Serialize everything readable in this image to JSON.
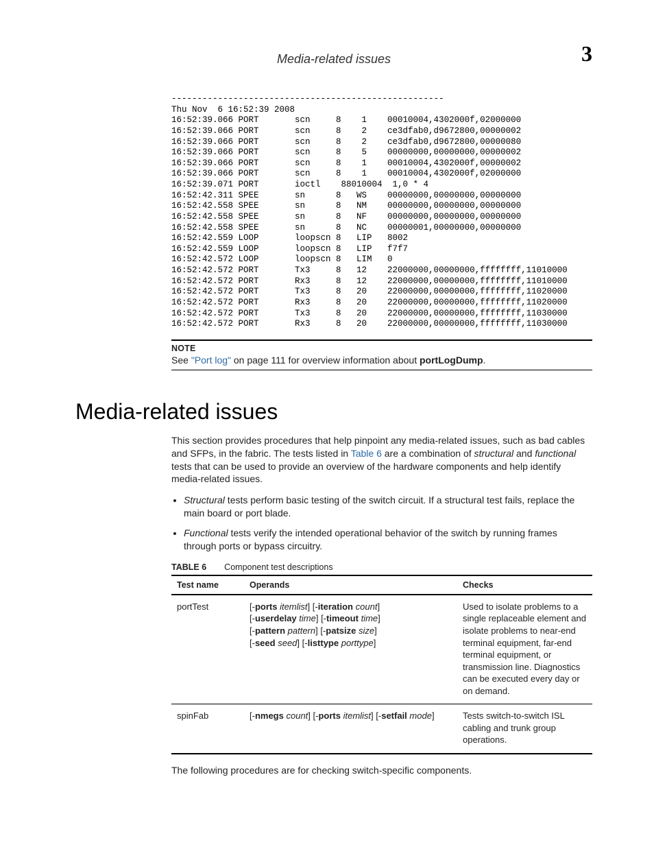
{
  "runningHead": {
    "title": "Media-related issues",
    "chapter": "3"
  },
  "log": "-----------------------------------------------------\nThu Nov  6 16:52:39 2008\n16:52:39.066 PORT       scn     8    1    00010004,4302000f,02000000\n16:52:39.066 PORT       scn     8    2    ce3dfab0,d9672800,00000002\n16:52:39.066 PORT       scn     8    2    ce3dfab0,d9672800,00000080\n16:52:39.066 PORT       scn     8    5    00000000,00000000,00000002\n16:52:39.066 PORT       scn     8    1    00010004,4302000f,00000002\n16:52:39.066 PORT       scn     8    1    00010004,4302000f,02000000\n16:52:39.071 PORT       ioctl    88010004  1,0 * 4\n16:52:42.311 SPEE       sn      8   WS    00000000,00000000,00000000\n16:52:42.558 SPEE       sn      8   NM    00000000,00000000,00000000\n16:52:42.558 SPEE       sn      8   NF    00000000,00000000,00000000\n16:52:42.558 SPEE       sn      8   NC    00000001,00000000,00000000\n16:52:42.559 LOOP       loopscn 8   LIP   8002\n16:52:42.559 LOOP       loopscn 8   LIP   f7f7\n16:52:42.572 LOOP       loopscn 8   LIM   0\n16:52:42.572 PORT       Tx3     8   12    22000000,00000000,ffffffff,11010000\n16:52:42.572 PORT       Rx3     8   12    22000000,00000000,ffffffff,11010000\n16:52:42.572 PORT       Tx3     8   20    22000000,00000000,ffffffff,11020000\n16:52:42.572 PORT       Rx3     8   20    22000000,00000000,ffffffff,11020000\n16:52:42.572 PORT       Tx3     8   20    22000000,00000000,ffffffff,11030000\n16:52:42.572 PORT       Rx3     8   20    22000000,00000000,ffffffff,11030000",
  "note": {
    "label": "NOTE",
    "pre": "See ",
    "link": "\"Port log\"",
    "mid": " on page 111 for overview information about ",
    "cmd": "portLogDump",
    "post": "."
  },
  "section": {
    "heading": "Media-related issues",
    "intro": {
      "p1a": "This section provides procedures that help pinpoint any media-related issues, such as bad cables and SFPs, in the fabric. The tests listed in ",
      "p1link": "Table 6",
      "p1b": " are a combination of ",
      "p1i1": "structural",
      "p1c": " and ",
      "p1i2": "functional",
      "p1d": " tests that can be used to provide an overview of the hardware components and help identify media-related issues."
    },
    "bullets": [
      {
        "em": "Structural",
        "text": " tests perform basic testing of the switch circuit. If a structural test fails, replace the main board or port blade."
      },
      {
        "em": "Functional",
        "text": " tests verify the intended operational behavior of the switch by running frames through ports or bypass circuitry."
      }
    ],
    "tableCaption": {
      "label": "TABLE 6",
      "title": "Component test descriptions"
    },
    "tableHead": {
      "c1": "Test name",
      "c2": "Operands",
      "c3": "Checks"
    },
    "rows": [
      {
        "name": "portTest",
        "ops": [
          [
            "[-",
            "ports",
            " ",
            "itemlist",
            "] [-",
            "iteration",
            " ",
            "count",
            "]"
          ],
          [
            "[-",
            "userdelay",
            " ",
            "time",
            "] [-",
            "timeout",
            " ",
            "time",
            "]"
          ],
          [
            "[-",
            "pattern",
            " ",
            "pattern",
            "] [-",
            "patsize",
            " ",
            "size",
            "]"
          ],
          [
            "[-",
            "seed",
            " ",
            "seed",
            "] [-",
            "listtype",
            " ",
            "porttype",
            "]"
          ]
        ],
        "checks": "Used to isolate problems to a single replaceable element and isolate problems to near-end terminal equipment, far-end terminal equipment, or transmission line. Diagnostics can be executed every day or on demand."
      },
      {
        "name": "spinFab",
        "ops": [
          [
            "[-",
            "nmegs",
            " ",
            "count",
            "] [-",
            "ports",
            " ",
            "itemlist",
            "] [-",
            "setfail",
            " ",
            "mode",
            "]"
          ]
        ],
        "checks": "Tests switch-to-switch ISL cabling and trunk group operations."
      }
    ],
    "outro": "The following procedures are for checking switch-specific components."
  }
}
